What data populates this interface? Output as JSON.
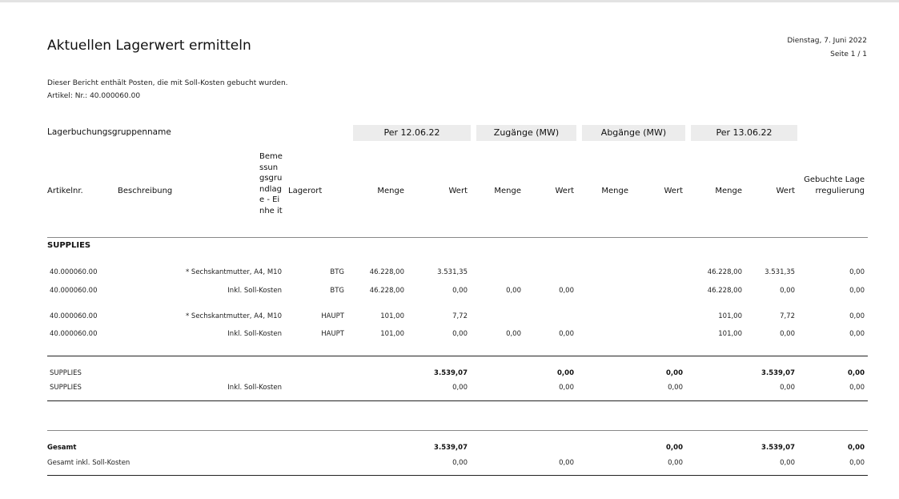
{
  "report": {
    "title": "Aktuellen Lagerwert ermitteln",
    "date": "Dienstag, 7. Juni 2022",
    "page": "Seite 1 / 1",
    "note1": "Dieser Bericht enthält Posten, die mit Soll-Kosten gebucht wurden.",
    "note2": "Artikel: Nr.: 40.000060.00"
  },
  "header": {
    "group_label": "Lagerbuchungsgruppenname",
    "groups": [
      "Per 12.06.22",
      "Zugänge (MW)",
      "Abgänge (MW)",
      "Per 13.06.22"
    ],
    "columns": {
      "item_no": "Artikelnr.",
      "description": "Beschreibung",
      "base_unit": "Beme ssun gsgru ndlag e - Einhe it",
      "location": "Lagerort",
      "qty1": "Menge",
      "val1": "Wert",
      "qty2": "Menge",
      "val2": "Wert",
      "qty3": "Menge",
      "val3": "Wert",
      "qty4": "Menge",
      "val4": "Wert",
      "adjust": "Gebuchte Lagerregulierung"
    }
  },
  "section": "SUPPLIES",
  "rows": [
    {
      "item": "40.000060.00",
      "desc": "* Sechskantmutter, A4, M10",
      "loc": "BTG",
      "q1": "46.228,00",
      "v1": "3.531,35",
      "q2": "",
      "v2": "",
      "q3": "",
      "v3": "",
      "q4": "46.228,00",
      "v4": "3.531,35",
      "adj": "0,00"
    },
    {
      "item": "40.000060.00",
      "desc": "Inkl. Soll-Kosten",
      "loc": "BTG",
      "q1": "46.228,00",
      "v1": "0,00",
      "q2": "0,00",
      "v2": "0,00",
      "q3": "",
      "v3": "",
      "q4": "46.228,00",
      "v4": "0,00",
      "adj": "0,00"
    },
    {
      "item": "40.000060.00",
      "desc": "* Sechskantmutter, A4, M10",
      "loc": "HAUPT",
      "q1": "101,00",
      "v1": "7,72",
      "q2": "",
      "v2": "",
      "q3": "",
      "v3": "",
      "q4": "101,00",
      "v4": "7,72",
      "adj": "0,00"
    },
    {
      "item": "40.000060.00",
      "desc": "Inkl. Soll-Kosten",
      "loc": "HAUPT",
      "q1": "101,00",
      "v1": "0,00",
      "q2": "0,00",
      "v2": "0,00",
      "q3": "",
      "v3": "",
      "q4": "101,00",
      "v4": "0,00",
      "adj": "0,00"
    }
  ],
  "subtotal": [
    {
      "label": "SUPPLIES",
      "desc": "",
      "v1": "3.539,07",
      "v2": "0,00",
      "v3": "0,00",
      "v4": "3.539,07",
      "adj": "0,00",
      "bold": true
    },
    {
      "label": "SUPPLIES",
      "desc": "Inkl. Soll-Kosten",
      "v1": "0,00",
      "v2": "0,00",
      "v3": "0,00",
      "v4": "0,00",
      "adj": "0,00",
      "bold": false
    }
  ],
  "total": [
    {
      "label": "Gesamt",
      "v1": "3.539,07",
      "v2": "",
      "v3": "0,00",
      "v4": "3.539,07",
      "adj": "0,00",
      "bold": true
    },
    {
      "label": "Gesamt inkl. Soll-Kosten",
      "v1": "0,00",
      "v2": "0,00",
      "v3": "0,00",
      "v4": "0,00",
      "adj": "0,00",
      "bold": false
    }
  ]
}
